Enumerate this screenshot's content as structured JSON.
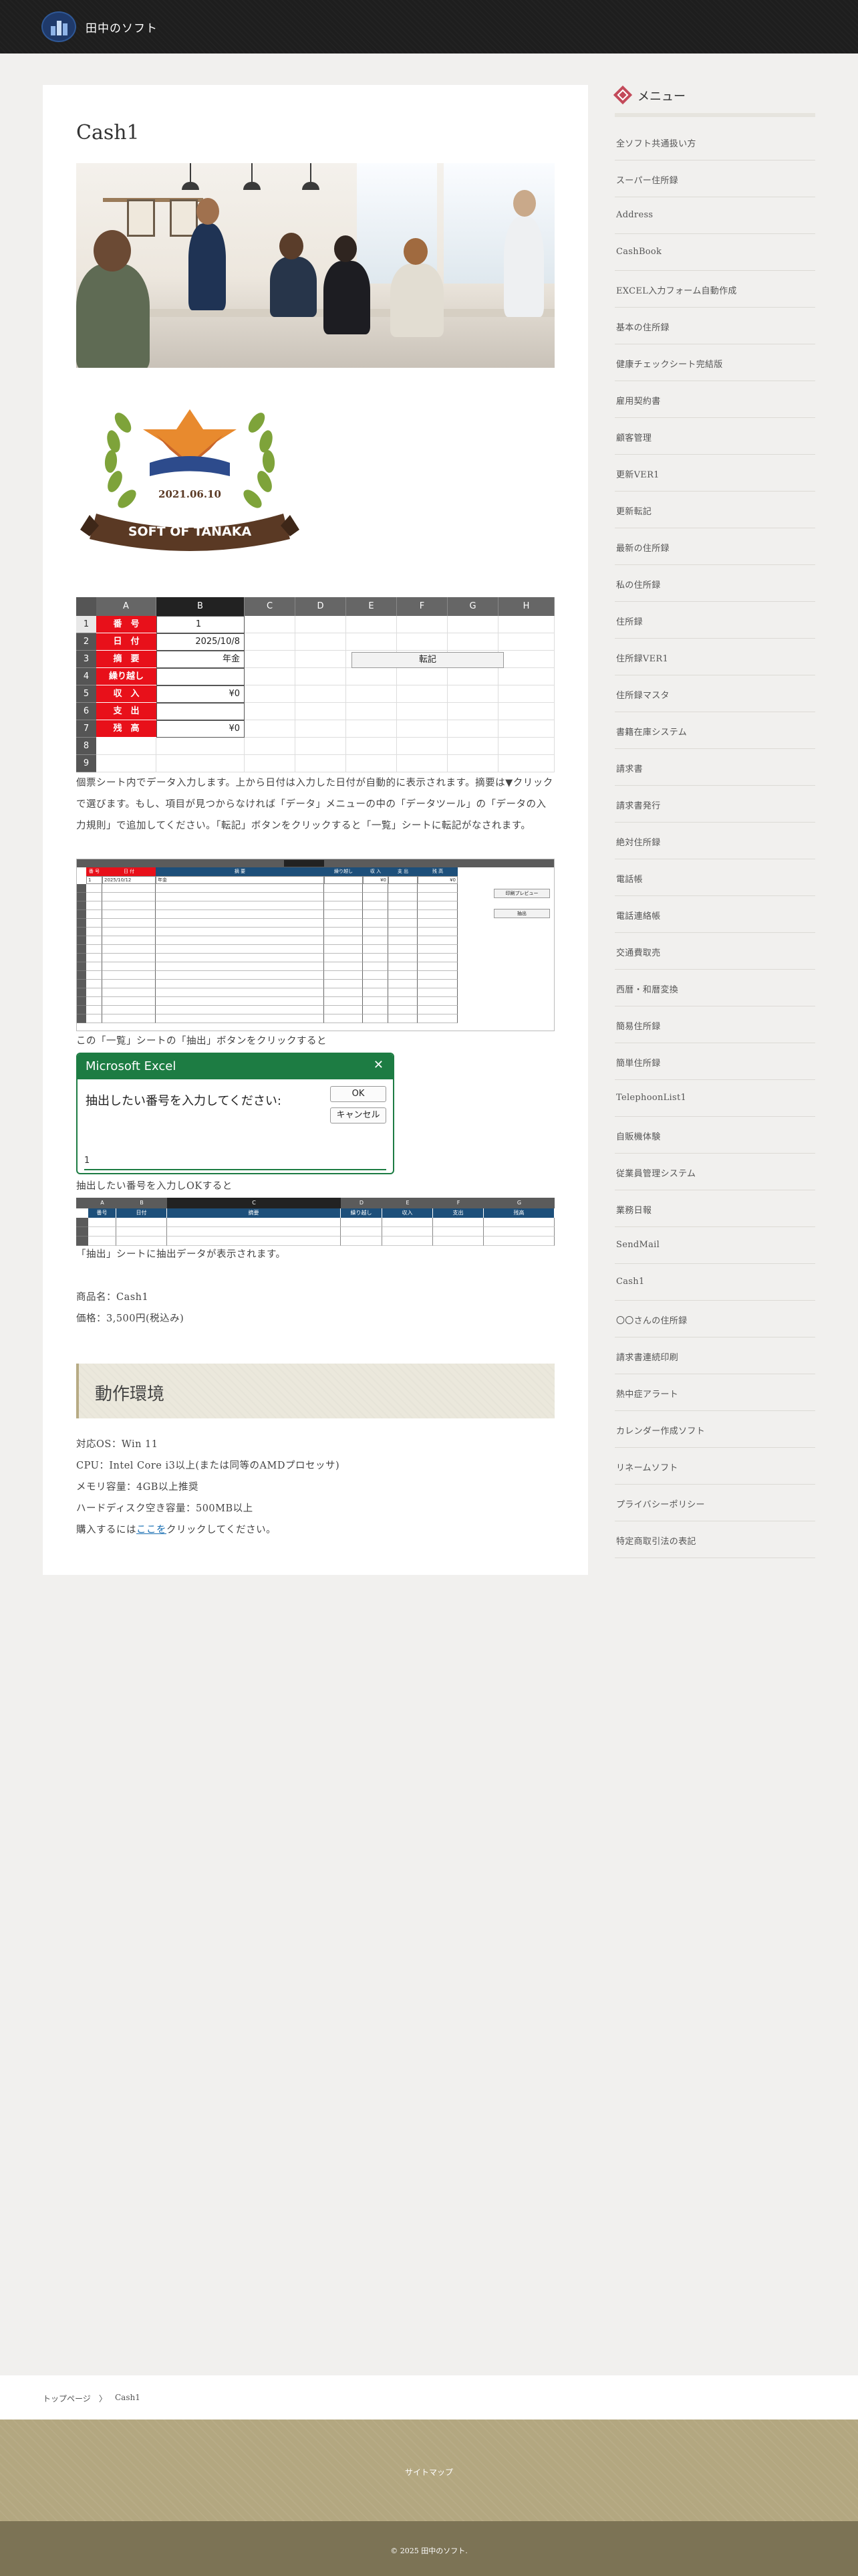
{
  "header": {
    "site_title": "田中のソフト"
  },
  "article": {
    "title": "Cash1",
    "badge": {
      "date": "2021.06.10",
      "ribbon": "SOFT OF TANAKA"
    },
    "sheet1": {
      "col_headers": [
        "A",
        "B",
        "C",
        "D",
        "E",
        "F",
        "G",
        "H"
      ],
      "row_numbers": [
        "1",
        "2",
        "3",
        "4",
        "5",
        "6",
        "7",
        "8",
        "9"
      ],
      "labels": [
        "番　号",
        "日　付",
        "摘　要",
        "繰り越し",
        "収　入",
        "支　出",
        "残　高"
      ],
      "values": [
        "1",
        "2025/10/8",
        "年金",
        "",
        "¥0",
        "",
        "¥0"
      ],
      "button": "転記"
    },
    "para1": "個票シート内でデータ入力します。上から日付は入力した日付が自動的に表示されます。摘要は▼クリックで選びます。もし、項目が見つからなければ「データ」メニューの中の「データツール」の「データの入力規則」で追加してください。「転記」ボタンをクリックすると「一覧」シートに転記がなされます。",
    "sheet2": {
      "header_row": [
        "番 号",
        "日 付",
        "摘 要",
        "繰り越し",
        "収 入",
        "支 出",
        "残 高"
      ],
      "first_row": [
        "1",
        "2025/10/12",
        "年金",
        "",
        "¥0",
        "",
        "¥0"
      ],
      "buttons": [
        "印刷プレビュー",
        "抽出"
      ]
    },
    "para2": "この「一覧」シートの「抽出」ボタンをクリックすると",
    "dialog": {
      "title": "Microsoft Excel",
      "prompt": "抽出したい番号を入力してください:",
      "ok": "OK",
      "cancel": "キャンセル",
      "input_value": "1"
    },
    "para3": "抽出したい番号を入力しOKすると",
    "sheet3": {
      "col_headers": [
        "A",
        "B",
        "C",
        "D",
        "E",
        "F",
        "G"
      ],
      "header_row": [
        "番号",
        "日付",
        "摘要",
        "繰り越し",
        "収入",
        "支出",
        "残高"
      ]
    },
    "para4": "「抽出」シートに抽出データが表示されます。",
    "product_name": "商品名：Cash1",
    "price": "価格：3,500円(税込み)",
    "section_title": "動作環境",
    "requirements": [
      "対応OS：Win 11",
      "CPU：Intel Core i3以上(または同等のAMDプロセッサ)",
      "メモリ容量：4GB以上推奨",
      "ハードディスク空き容量：500MB以上"
    ],
    "buy_prefix": "購入するには",
    "buy_link": "ここを",
    "buy_suffix": "クリックしてください。"
  },
  "sidebar": {
    "title": "メニュー",
    "items": [
      "全ソフト共通扱い方",
      "スーパー住所録",
      "Address",
      "CashBook",
      "EXCEL入力フォーム自動作成",
      "基本の住所録",
      "健康チェックシート完結版",
      "雇用契約書",
      "顧客管理",
      "更新VER1",
      "更新転記",
      "最新の住所録",
      "私の住所録",
      "住所録",
      "住所録VER1",
      "住所録マスタ",
      "書籍在庫システム",
      "請求書",
      "請求書発行",
      "絶対住所録",
      "電話帳",
      "電話連絡帳",
      "交通費取売",
      "西暦・和暦変換",
      "簡易住所録",
      "簡単住所録",
      "TelephoonList1",
      "自販機体験",
      "従業員管理システム",
      "業務日報",
      "SendMail",
      "Cash1",
      "〇〇さんの住所録",
      "請求書連続印刷",
      "熱中症アラート",
      "カレンダー作成ソフト",
      "リネームソフト",
      "プライバシーポリシー",
      "特定商取引法の表記"
    ]
  },
  "breadcrumb": {
    "home": "トップページ",
    "separator": "〉",
    "current": "Cash1"
  },
  "footer": {
    "sitemap": "サイトマップ",
    "copyright": "© 2025 田中のソフト."
  }
}
